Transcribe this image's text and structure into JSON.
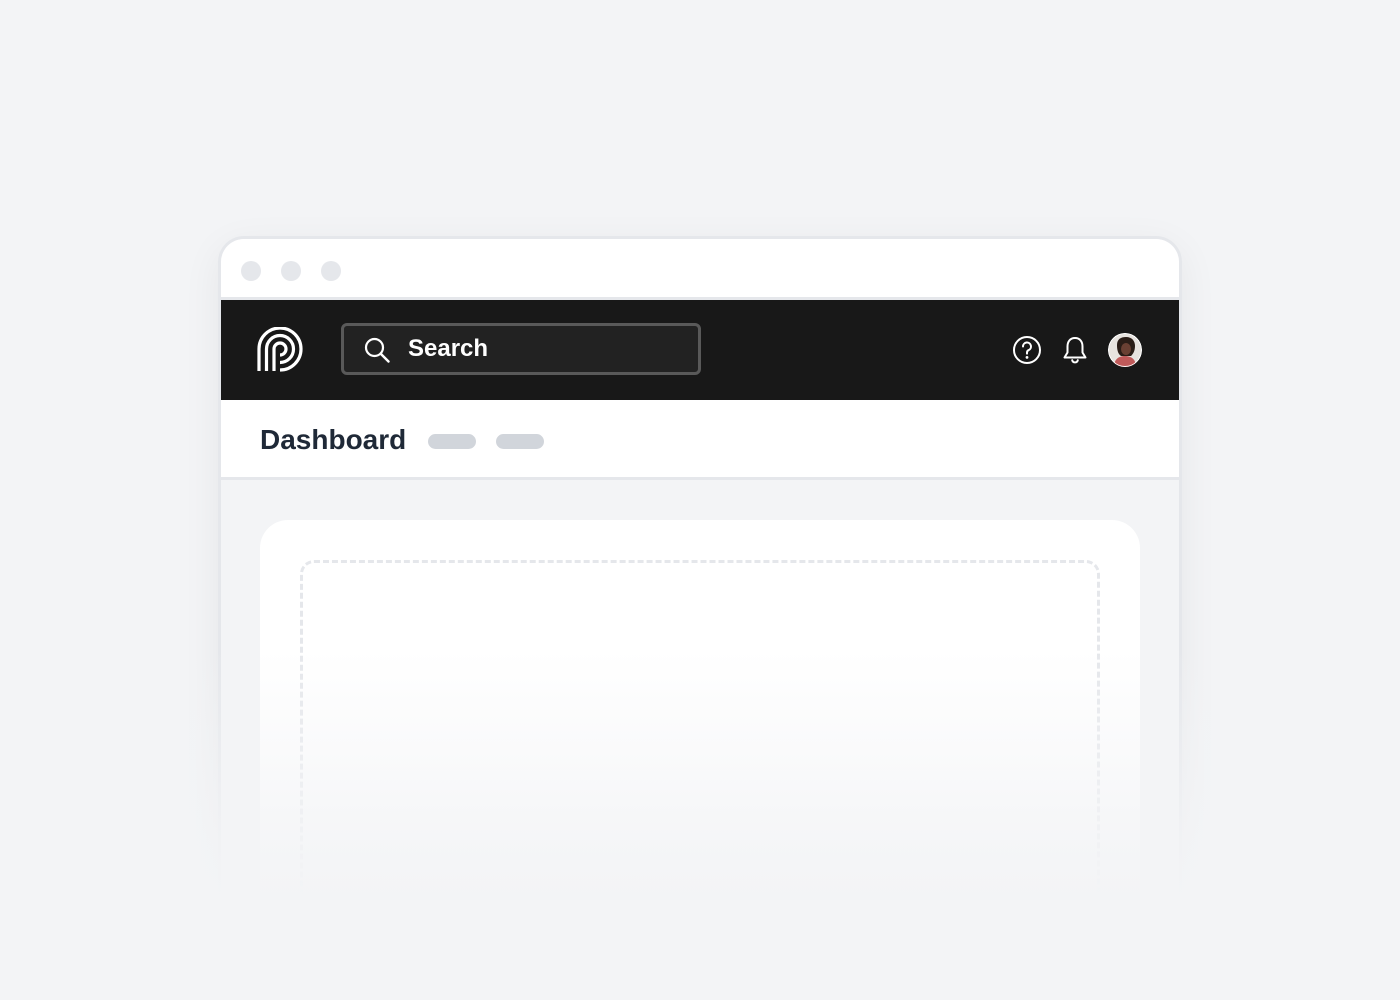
{
  "window": {
    "controls": [
      "close-dot",
      "minimize-dot",
      "maximize-dot"
    ]
  },
  "header": {
    "logo_icon": "brand-logo-icon",
    "search": {
      "placeholder": "Search",
      "value": "",
      "icon": "search-icon"
    },
    "actions": [
      {
        "icon": "help-circle-icon"
      },
      {
        "icon": "bell-icon"
      },
      {
        "icon": "avatar"
      }
    ]
  },
  "subheader": {
    "title": "Dashboard",
    "placeholders": [
      "pill-1",
      "pill-2"
    ]
  },
  "colors": {
    "page_background": "#f3f4f6",
    "header_background": "#181818",
    "header_text": "#ffffff",
    "title_text": "#1f2937",
    "pill": "#d1d5db",
    "border": "#e5e7eb"
  }
}
